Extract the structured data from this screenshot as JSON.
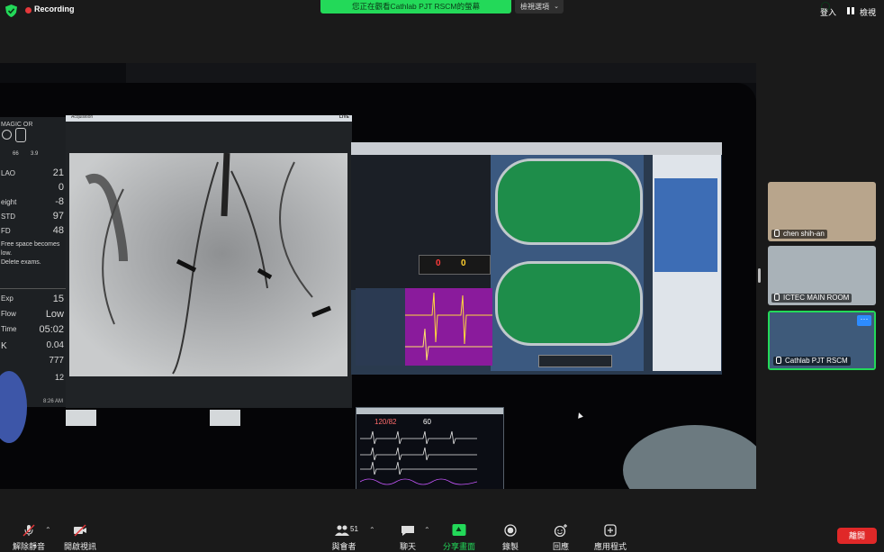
{
  "app": {
    "accent": "#23d959",
    "danger": "#e02828"
  },
  "topbar": {
    "recording_label": "Recording",
    "share_banner": "您正在觀看Cathlab PJT RSCM的螢幕",
    "view_options": "檢視選項",
    "signin": "登入",
    "view": "檢視"
  },
  "shared_screen": {
    "xray_header_left": "Acquisition",
    "xray_header_right": "LIVE",
    "stats_top": "MAGIC OR",
    "stats_top_a": "66",
    "stats_top_b": "3.9",
    "stats": [
      {
        "label": "LAO",
        "value": "21"
      },
      {
        "label": "",
        "value": "0"
      },
      {
        "label": "eight",
        "value": "-8"
      },
      {
        "label": "STD",
        "value": "97"
      },
      {
        "label": "FD",
        "value": "48"
      }
    ],
    "notes": [
      "Free space becomes",
      "low.",
      "Delete exams."
    ],
    "stats2": [
      {
        "label": "Exp",
        "value": "15"
      },
      {
        "label": "Flow",
        "value": "Low"
      },
      {
        "label": "Time",
        "value": "05:02"
      },
      {
        "label": "K",
        "value": "0.04"
      },
      {
        "label": "",
        "value": "777"
      },
      {
        "label": "",
        "value": "12"
      }
    ],
    "clock": "8:26 AM",
    "counter": [
      "0",
      "0"
    ],
    "vitals_bp": "120/82",
    "vitals_hr": "60"
  },
  "participants": [
    {
      "name": "chen shih-an",
      "bg": "#b8a58c"
    },
    {
      "name": "ICTEC MAIN ROOM",
      "bg": "#a9b2b8"
    },
    {
      "name": "Cathlab PJT RSCM",
      "bg": "#3e5a7a",
      "more": "···"
    }
  ],
  "toolbar": {
    "unmute": "解除靜音",
    "start_video": "開啟視訊",
    "participants": "與會者",
    "participants_count": "51",
    "chat": "聊天",
    "share": "分享畫面",
    "record": "錄製",
    "reactions": "回應",
    "apps": "應用程式",
    "leave": "離開"
  }
}
